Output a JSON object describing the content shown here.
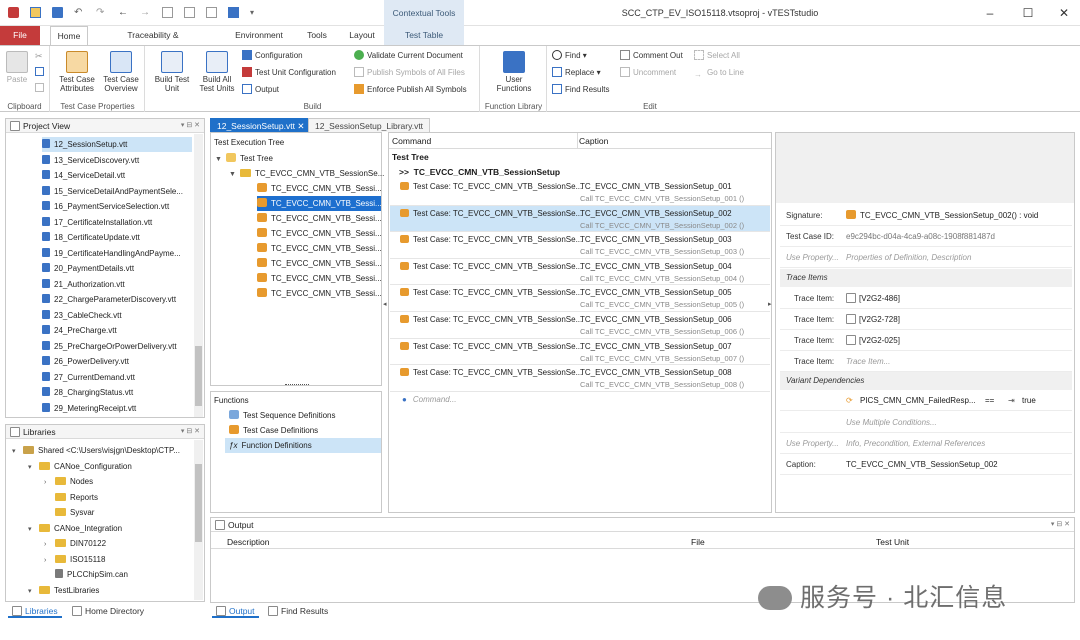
{
  "window": {
    "title": "SCC_CTP_EV_ISO15118.vtsoproj - vTESTstudio",
    "contextual_tools": "Contextual Tools"
  },
  "ribbon_tabs": [
    "File",
    "Home",
    "Traceability & Documentation",
    "Environment",
    "Tools",
    "Layout",
    "Test Table"
  ],
  "ribbon": {
    "clipboard": {
      "group": "Clipboard",
      "paste": "Paste"
    },
    "tcprops": {
      "group": "Test Case Properties",
      "attributes": "Test Case\nAttributes",
      "overview": "Test Case\nOverview"
    },
    "build": {
      "group": "Build",
      "build_unit": "Build Test\nUnit",
      "build_all": "Build All\nTest Units",
      "configuration": "Configuration",
      "unit_config": "Test Unit Configuration",
      "output": "Output",
      "validate": "Validate Current Document",
      "publish": "Publish Symbols of All Files",
      "enforce": "Enforce Publish All Symbols"
    },
    "functions": {
      "group": "Function Library",
      "user_functions": "User\nFunctions"
    },
    "edit": {
      "group": "Edit",
      "find": "Find",
      "replace": "Replace",
      "find_results": "Find Results",
      "comment_out": "Comment Out",
      "uncomment": "Uncomment",
      "select_all": "Select All",
      "goto_line": "Go to Line"
    }
  },
  "project_view": {
    "title": "Project View",
    "items": [
      "12_SessionSetup.vtt",
      "13_ServiceDiscovery.vtt",
      "14_ServiceDetail.vtt",
      "15_ServiceDetailAndPaymentSele...",
      "16_PaymentServiceSelection.vtt",
      "17_CertificateInstallation.vtt",
      "18_CertificateUpdate.vtt",
      "19_CertificateHandlingAndPayme...",
      "20_PaymentDetails.vtt",
      "21_Authorization.vtt",
      "22_ChargeParameterDiscovery.vtt",
      "23_CableCheck.vtt",
      "24_PreCharge.vtt",
      "25_PreChargeOrPowerDelivery.vtt",
      "26_PowerDelivery.vtt",
      "27_CurrentDemand.vtt",
      "28_ChargingStatus.vtt",
      "29_MeteringReceipt.vtt"
    ]
  },
  "libraries": {
    "title": "Libraries",
    "items": [
      {
        "label": "Shared <C:\\Users\\visjgn\\Desktop\\CTP...",
        "type": "shared",
        "level": 0
      },
      {
        "label": "CANoe_Configuration",
        "type": "folder",
        "level": 1
      },
      {
        "label": "Nodes",
        "type": "folder",
        "level": 2
      },
      {
        "label": "Reports",
        "type": "folder",
        "level": 2
      },
      {
        "label": "Sysvar",
        "type": "folder",
        "level": 2
      },
      {
        "label": "CANoe_Integration",
        "type": "folder",
        "level": 1
      },
      {
        "label": "DIN70122",
        "type": "folder",
        "level": 2
      },
      {
        "label": "ISO15118",
        "type": "folder",
        "level": 2
      },
      {
        "label": "PLCChipSim.can",
        "type": "file",
        "level": 2
      },
      {
        "label": "TestLibraries",
        "type": "folder",
        "level": 1
      }
    ]
  },
  "bottom_left_tabs": [
    "Libraries",
    "Home Directory"
  ],
  "doc_tabs": [
    "12_SessionSetup.vtt",
    "12_SessionSetup_Library.vtt"
  ],
  "exec_tree": {
    "title": "Test Execution Tree",
    "root": "Test Tree",
    "group": "TC_EVCC_CMN_VTB_SessionSe...",
    "cases": [
      "TC_EVCC_CMN_VTB_Sessi...",
      "TC_EVCC_CMN_VTB_Sessi...",
      "TC_EVCC_CMN_VTB_Sessi...",
      "TC_EVCC_CMN_VTB_Sessi...",
      "TC_EVCC_CMN_VTB_Sessi...",
      "TC_EVCC_CMN_VTB_Sessi...",
      "TC_EVCC_CMN_VTB_Sessi...",
      "TC_EVCC_CMN_VTB_Sessi..."
    ]
  },
  "functions_pane": {
    "title": "Functions",
    "items": [
      "Test Sequence Definitions",
      "Test Case Definitions",
      "Function Definitions"
    ]
  },
  "command_table": {
    "col_command": "Command",
    "col_caption": "Caption",
    "section": "Test Tree",
    "group_prefix": ">>",
    "group_name": "TC_EVCC_CMN_VTB_SessionSetup",
    "rows": [
      {
        "cmd": "Test Case: TC_EVCC_CMN_VTB_SessionSe...",
        "caption": "TC_EVCC_CMN_VTB_SessionSetup_001",
        "call": "Call TC_EVCC_CMN_VTB_SessionSetup_001 ()"
      },
      {
        "cmd": "Test Case: TC_EVCC_CMN_VTB_SessionSe...",
        "caption": "TC_EVCC_CMN_VTB_SessionSetup_002",
        "call": "Call TC_EVCC_CMN_VTB_SessionSetup_002 ()"
      },
      {
        "cmd": "Test Case: TC_EVCC_CMN_VTB_SessionSe...",
        "caption": "TC_EVCC_CMN_VTB_SessionSetup_003",
        "call": "Call TC_EVCC_CMN_VTB_SessionSetup_003 ()"
      },
      {
        "cmd": "Test Case: TC_EVCC_CMN_VTB_SessionSe...",
        "caption": "TC_EVCC_CMN_VTB_SessionSetup_004",
        "call": "Call TC_EVCC_CMN_VTB_SessionSetup_004 ()"
      },
      {
        "cmd": "Test Case: TC_EVCC_CMN_VTB_SessionSe...",
        "caption": "TC_EVCC_CMN_VTB_SessionSetup_005",
        "call": "Call TC_EVCC_CMN_VTB_SessionSetup_005 ()"
      },
      {
        "cmd": "Test Case: TC_EVCC_CMN_VTB_SessionSe...",
        "caption": "TC_EVCC_CMN_VTB_SessionSetup_006",
        "call": "Call TC_EVCC_CMN_VTB_SessionSetup_006 ()"
      },
      {
        "cmd": "Test Case: TC_EVCC_CMN_VTB_SessionSe...",
        "caption": "TC_EVCC_CMN_VTB_SessionSetup_007",
        "call": "Call TC_EVCC_CMN_VTB_SessionSetup_007 ()"
      },
      {
        "cmd": "Test Case: TC_EVCC_CMN_VTB_SessionSe...",
        "caption": "TC_EVCC_CMN_VTB_SessionSetup_008",
        "call": "Call TC_EVCC_CMN_VTB_SessionSetup_008 ()"
      }
    ],
    "new_command": "Command..."
  },
  "properties": {
    "signature_label": "Signature:",
    "signature_value": "TC_EVCC_CMN_VTB_SessionSetup_002() : void",
    "tcid_label": "Test Case ID:",
    "tcid_value": "e9c294bc-d04a-4ca9-a08c-1908f881487d",
    "use_property_label": "Use Property...",
    "use_property_hint": "Properties of Definition, Description",
    "trace_section": "Trace Items",
    "trace_label": "Trace Item:",
    "trace_items": [
      "[V2G2-486]",
      "[V2G2-728]",
      "[V2G2-025]"
    ],
    "trace_hint": "Trace Item...",
    "variant_section": "Variant Dependencies",
    "variant_name": "PICS_CMN_CMN_FailedResp...",
    "variant_op": "==",
    "variant_value": "true",
    "multiple_conditions": "Use Multiple Conditions...",
    "use_property2_label": "Use Property...",
    "use_property2_hint": "Info, Precondition, External References",
    "caption_label": "Caption:",
    "caption_value": "TC_EVCC_CMN_VTB_SessionSetup_002"
  },
  "output": {
    "title": "Output",
    "cols": [
      "Description",
      "File",
      "Test Unit"
    ]
  },
  "bottom_tabs": [
    "Output",
    "Find Results"
  ],
  "watermark": "服务号 · 北汇信息",
  "colors": {
    "accent": "#1f70c9",
    "file_tab": "#c43b3b",
    "selection": "#cce4f7",
    "contextual": "#dfe9f4"
  }
}
